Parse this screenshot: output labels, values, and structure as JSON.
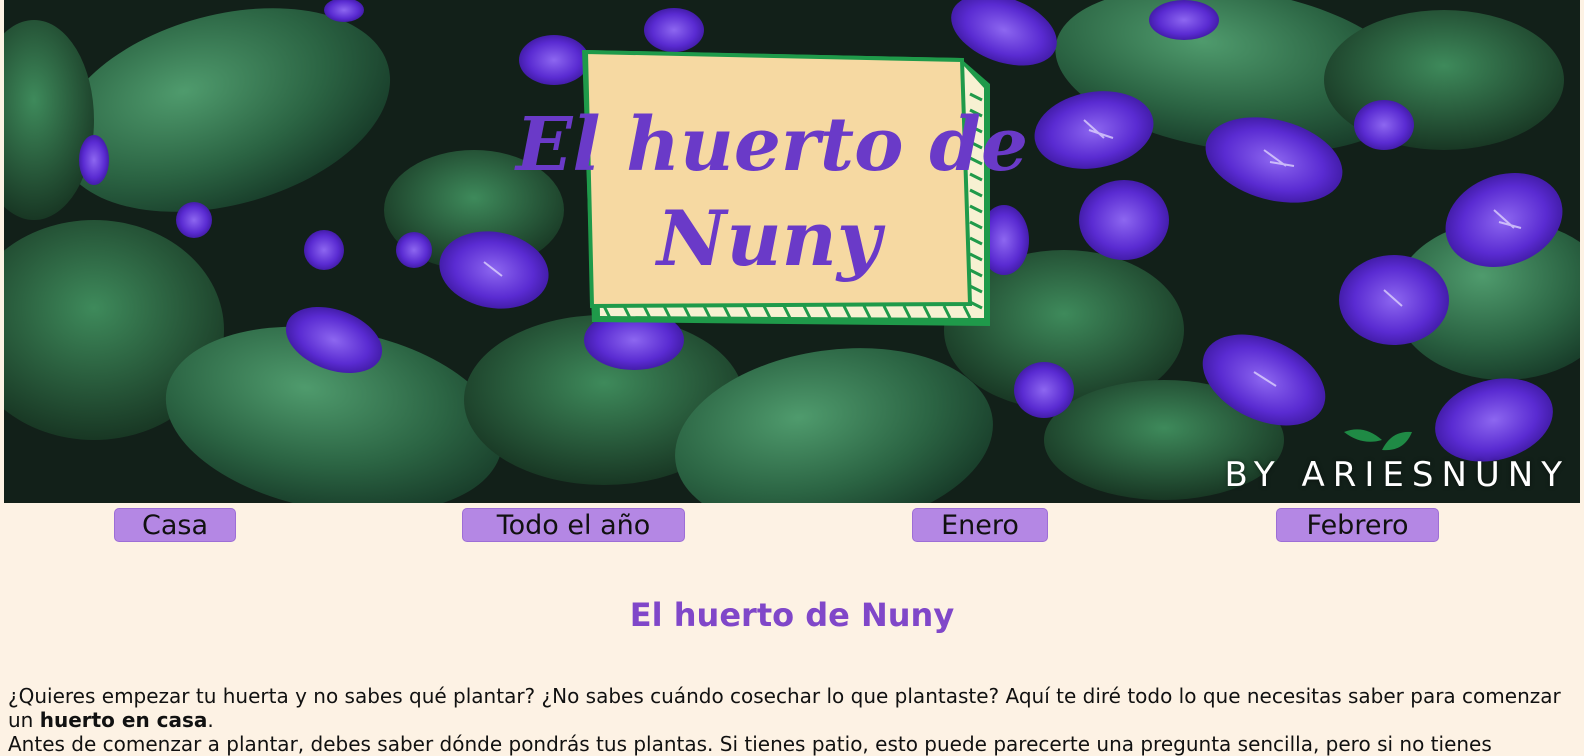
{
  "header": {
    "logo_text_line1": "El huerto de",
    "logo_text_line2": "Nuny",
    "byline": "BY ARIESNUNY"
  },
  "nav": {
    "items": [
      {
        "label": "Casa"
      },
      {
        "label": "Todo el año"
      },
      {
        "label": "Enero"
      },
      {
        "label": "Febrero"
      }
    ]
  },
  "main": {
    "title": "El huerto de Nuny",
    "intro_text": "¿Quieres empezar tu huerta y no sabes qué plantar? ¿No sabes cuándo cosechar lo que plantaste? Aquí te diré todo lo que necesitas saber para comenzar un ",
    "intro_bold": "huerto en casa",
    "intro_end": ".",
    "second_text": "Antes de comenzar a plantar, debes saber dónde pondrás tus plantas. Si tienes patio, esto puede parecerte una pregunta sencilla, pero si no tienes"
  },
  "colors": {
    "page_background": "#fdf2e4",
    "nav_button": "#b487e4",
    "heading": "#8047c9",
    "sign_fill": "#f6d9a2",
    "sign_border": "#1f9a4a",
    "flower": "#5b2bd0",
    "leaf": "#2e6b45"
  }
}
